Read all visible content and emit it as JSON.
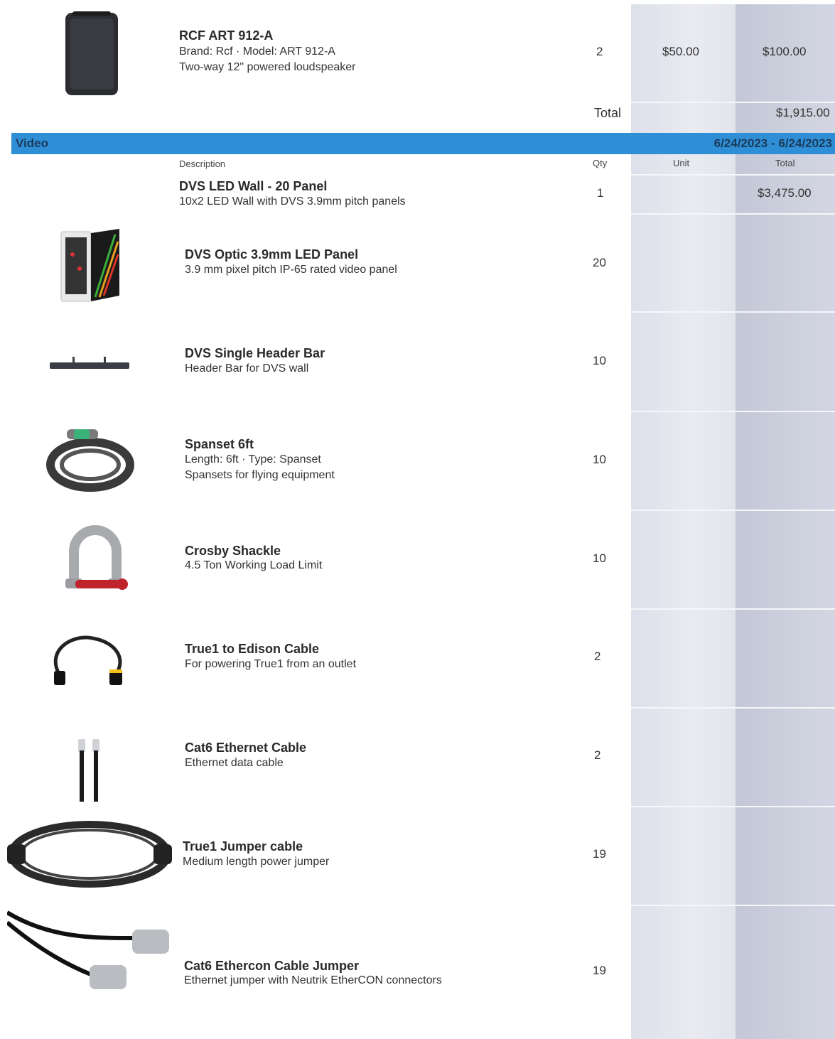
{
  "top_item": {
    "name": "RCF ART 912-A",
    "meta": "Brand: Rcf · Model: ART 912-A",
    "desc": "Two-way 12\" powered loudspeaker",
    "qty": "2",
    "unit": "$50.00",
    "total": "$100.00"
  },
  "section_total": {
    "label": "Total",
    "value": "$1,915.00"
  },
  "section": {
    "title": "Video",
    "dates": "6/24/2023 - 6/24/2023",
    "headers": {
      "description": "Description",
      "qty": "Qty",
      "unit": "Unit",
      "total": "Total"
    }
  },
  "package": {
    "name": "DVS LED Wall - 20 Panel",
    "desc": "10x2 LED Wall with DVS 3.9mm pitch panels",
    "qty": "1",
    "total": "$3,475.00"
  },
  "items": [
    {
      "name": "DVS Optic 3.9mm LED Panel",
      "lines": [
        "3.9 mm pixel pitch IP-65 rated video panel"
      ],
      "qty": "20",
      "icon": "led-panel-icon"
    },
    {
      "name": "DVS Single Header Bar",
      "lines": [
        "Header Bar for DVS wall"
      ],
      "qty": "10",
      "icon": "header-bar-icon"
    },
    {
      "name": "Spanset 6ft",
      "lines": [
        "Length: 6ft · Type: Spanset",
        "Spansets for flying equipment"
      ],
      "qty": "10",
      "icon": "spanset-icon"
    },
    {
      "name": "Crosby Shackle",
      "lines": [
        "4.5 Ton Working Load Limit"
      ],
      "qty": "10",
      "icon": "shackle-icon"
    },
    {
      "name": "True1 to Edison Cable",
      "lines": [
        "For powering True1 from an outlet"
      ],
      "qty": "2",
      "icon": "power-cable-icon"
    },
    {
      "name": "Cat6 Ethernet Cable",
      "lines": [
        "Ethernet data cable"
      ],
      "qty": "2",
      "icon": "ethernet-cable-icon"
    },
    {
      "name": "True1 Jumper cable",
      "lines": [
        "Medium length power jumper"
      ],
      "qty": "19",
      "icon": "jumper-cable-icon"
    },
    {
      "name": "Cat6 Ethercon Cable Jumper",
      "lines": [
        "Ethernet jumper with Neutrik EtherCON connectors"
      ],
      "qty": "19",
      "icon": "ethercon-cable-icon"
    }
  ],
  "colors": {
    "section_band": "#2f8fd6",
    "unit_column": "#e6e8ef",
    "total_column": "#cdd0dc"
  }
}
